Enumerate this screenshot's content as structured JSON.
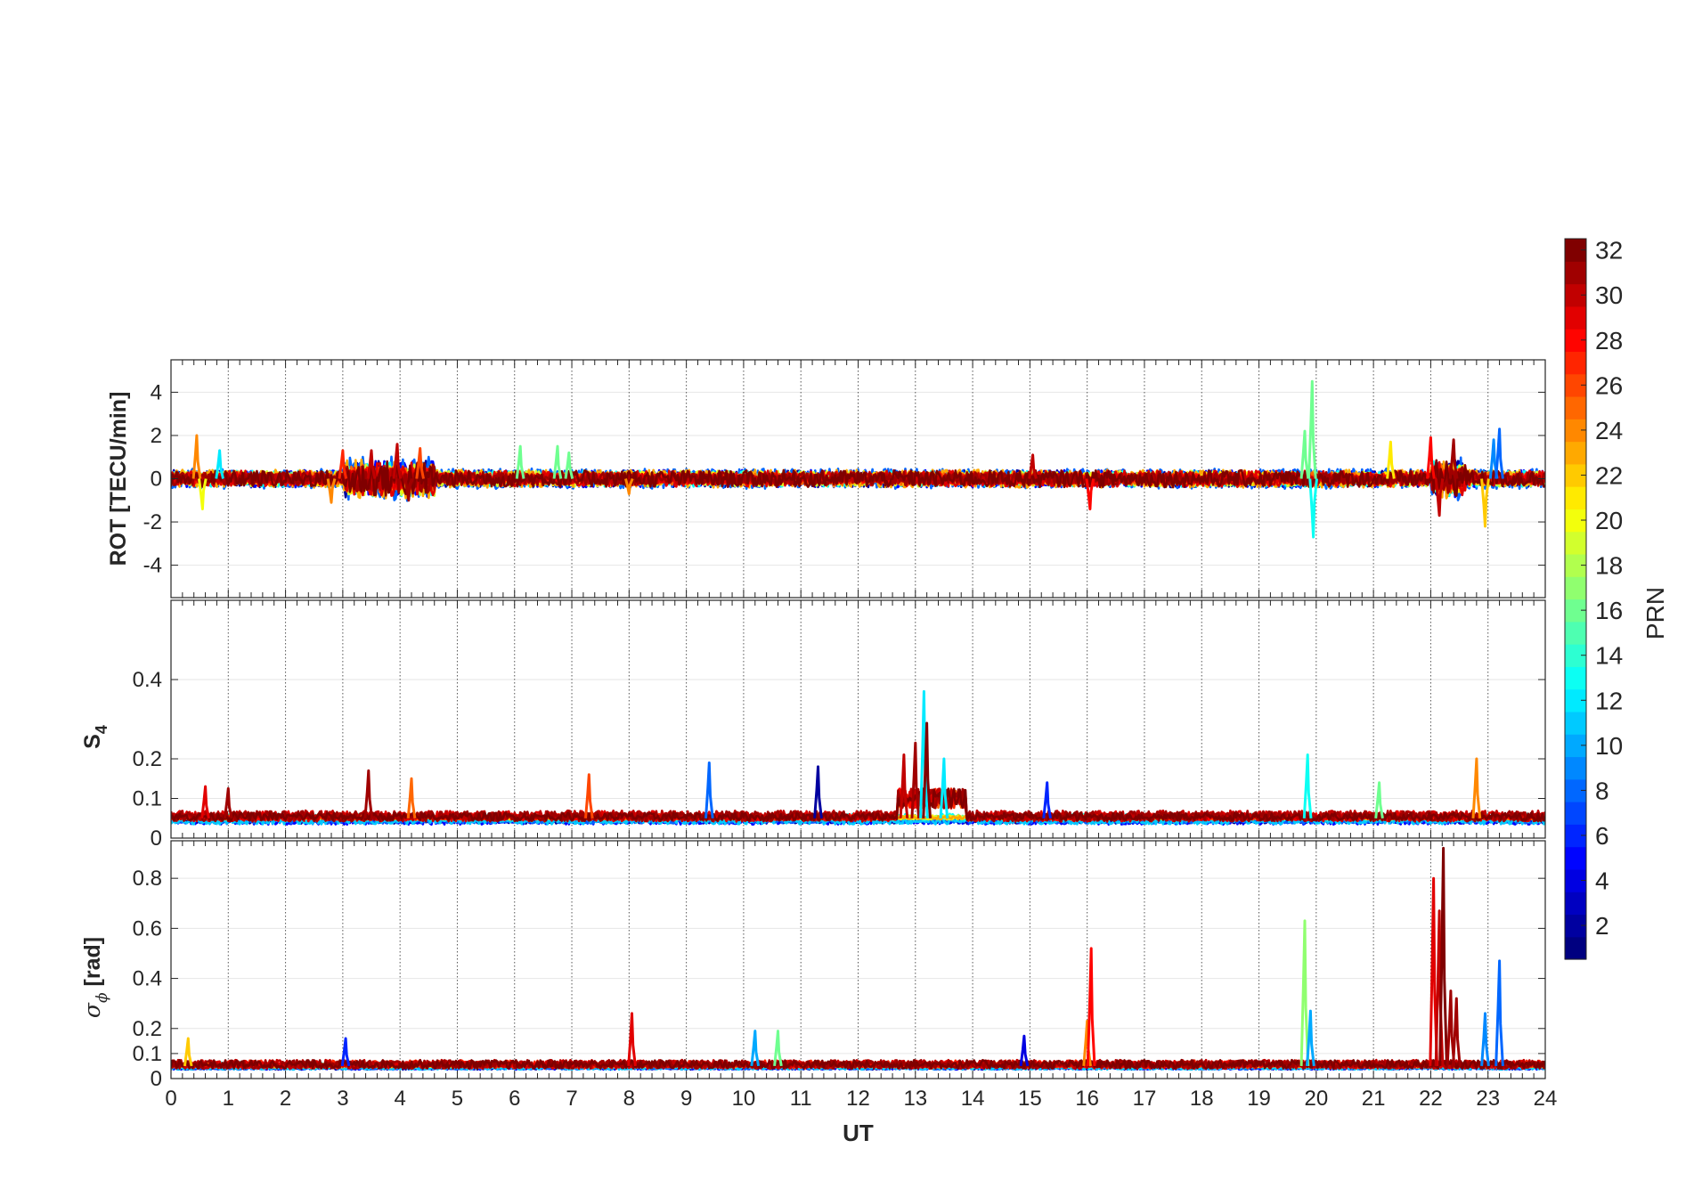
{
  "chart_data": [
    {
      "type": "line",
      "ylabel": "ROT [TECU/min]",
      "xlim": [
        0,
        24
      ],
      "ylim": [
        -5.5,
        5.5
      ],
      "yticks": [
        "-4",
        "-2",
        "0",
        "2",
        "4"
      ],
      "ytick_values": [
        -4,
        -2,
        0,
        2,
        4
      ],
      "grid": true,
      "series_note_color_by": "PRN",
      "baseline": 0,
      "noise_amplitude": 0.35,
      "events": [
        {
          "t": 0.45,
          "amp": 2.0,
          "prn": 24
        },
        {
          "t": 0.55,
          "amp": -1.4,
          "prn": 20
        },
        {
          "t": 0.85,
          "amp": 1.3,
          "prn": 12
        },
        {
          "t": 2.8,
          "amp": -1.1,
          "prn": 24
        },
        {
          "t": 3.0,
          "amp": 1.3,
          "prn": 27
        },
        {
          "t": 3.5,
          "amp": 1.3,
          "prn": 30
        },
        {
          "t": 3.95,
          "amp": 1.6,
          "prn": 30
        },
        {
          "t": 4.15,
          "amp": -1.0,
          "prn": 31
        },
        {
          "t": 4.35,
          "amp": 1.4,
          "prn": 26
        },
        {
          "t": 6.1,
          "amp": 1.5,
          "prn": 16
        },
        {
          "t": 6.75,
          "amp": 1.5,
          "prn": 16
        },
        {
          "t": 6.95,
          "amp": 1.2,
          "prn": 16
        },
        {
          "t": 8.0,
          "amp": -0.7,
          "prn": 24
        },
        {
          "t": 15.05,
          "amp": 1.1,
          "prn": 30
        },
        {
          "t": 16.05,
          "amp": -1.4,
          "prn": 28
        },
        {
          "t": 19.8,
          "amp": 2.2,
          "prn": 16
        },
        {
          "t": 19.93,
          "amp": 4.5,
          "prn": 16
        },
        {
          "t": 19.95,
          "amp": -2.7,
          "prn": 13
        },
        {
          "t": 21.3,
          "amp": 1.7,
          "prn": 21
        },
        {
          "t": 22.0,
          "amp": 1.9,
          "prn": 28
        },
        {
          "t": 22.15,
          "amp": -1.7,
          "prn": 30
        },
        {
          "t": 22.4,
          "amp": 1.8,
          "prn": 31
        },
        {
          "t": 22.95,
          "amp": -2.2,
          "prn": 22
        },
        {
          "t": 23.1,
          "amp": 1.8,
          "prn": 9
        },
        {
          "t": 23.2,
          "amp": 2.3,
          "prn": 8
        }
      ]
    },
    {
      "type": "line",
      "ylabel": "S4",
      "xlim": [
        0,
        24
      ],
      "ylim": [
        0,
        0.6
      ],
      "yticks": [
        "0",
        "0.1",
        "0.2",
        "0.4"
      ],
      "ytick_values": [
        0,
        0.1,
        0.2,
        0.4
      ],
      "grid": true,
      "baseline": 0.05,
      "noise_amplitude": 0.02,
      "events": [
        {
          "t": 0.6,
          "amp": 0.08,
          "prn": 29
        },
        {
          "t": 1.0,
          "amp": 0.075,
          "prn": 31
        },
        {
          "t": 3.45,
          "amp": 0.12,
          "prn": 31
        },
        {
          "t": 4.2,
          "amp": 0.1,
          "prn": 25
        },
        {
          "t": 7.3,
          "amp": 0.11,
          "prn": 26
        },
        {
          "t": 9.4,
          "amp": 0.14,
          "prn": 8
        },
        {
          "t": 11.3,
          "amp": 0.13,
          "prn": 2
        },
        {
          "t": 12.8,
          "amp": 0.16,
          "prn": 30
        },
        {
          "t": 13.0,
          "amp": 0.19,
          "prn": 31
        },
        {
          "t": 13.15,
          "amp": 0.32,
          "prn": 12
        },
        {
          "t": 13.2,
          "amp": 0.24,
          "prn": 32
        },
        {
          "t": 13.5,
          "amp": 0.15,
          "prn": 12
        },
        {
          "t": 15.3,
          "amp": 0.09,
          "prn": 6
        },
        {
          "t": 19.85,
          "amp": 0.16,
          "prn": 13
        },
        {
          "t": 21.1,
          "amp": 0.09,
          "prn": 16
        },
        {
          "t": 22.8,
          "amp": 0.15,
          "prn": 24
        }
      ],
      "plateau": {
        "start": 12.7,
        "end": 13.9,
        "level": 0.1
      }
    },
    {
      "type": "line",
      "ylabel": "σϕ [rad]",
      "xlabel": "UT",
      "xlim": [
        0,
        24
      ],
      "ylim": [
        0,
        0.95
      ],
      "xticks": [
        "0",
        "1",
        "2",
        "3",
        "4",
        "5",
        "6",
        "7",
        "8",
        "9",
        "10",
        "11",
        "12",
        "13",
        "14",
        "15",
        "16",
        "17",
        "18",
        "19",
        "20",
        "21",
        "22",
        "23",
        "24"
      ],
      "yticks": [
        "0",
        "0.1",
        "0.2",
        "0.4",
        "0.6",
        "0.8"
      ],
      "ytick_values": [
        0,
        0.1,
        0.2,
        0.4,
        0.6,
        0.8
      ],
      "grid": true,
      "baseline": 0.05,
      "noise_amplitude": 0.025,
      "events": [
        {
          "t": 0.3,
          "amp": 0.11,
          "prn": 22
        },
        {
          "t": 3.05,
          "amp": 0.11,
          "prn": 6
        },
        {
          "t": 8.05,
          "amp": 0.21,
          "prn": 29
        },
        {
          "t": 10.2,
          "amp": 0.14,
          "prn": 10
        },
        {
          "t": 10.6,
          "amp": 0.14,
          "prn": 16
        },
        {
          "t": 14.9,
          "amp": 0.12,
          "prn": 4
        },
        {
          "t": 16.0,
          "amp": 0.18,
          "prn": 24
        },
        {
          "t": 16.07,
          "amp": 0.47,
          "prn": 28
        },
        {
          "t": 19.8,
          "amp": 0.58,
          "prn": 17
        },
        {
          "t": 19.9,
          "amp": 0.22,
          "prn": 10
        },
        {
          "t": 22.05,
          "amp": 0.75,
          "prn": 29
        },
        {
          "t": 22.15,
          "amp": 0.62,
          "prn": 30
        },
        {
          "t": 22.22,
          "amp": 0.87,
          "prn": 32
        },
        {
          "t": 22.35,
          "amp": 0.3,
          "prn": 31
        },
        {
          "t": 22.45,
          "amp": 0.27,
          "prn": 31
        },
        {
          "t": 22.95,
          "amp": 0.21,
          "prn": 9
        },
        {
          "t": 23.2,
          "amp": 0.42,
          "prn": 8
        }
      ]
    }
  ],
  "colorbar": {
    "label": "PRN",
    "range": [
      1,
      32
    ],
    "ticks": [
      "2",
      "4",
      "6",
      "8",
      "10",
      "12",
      "14",
      "16",
      "18",
      "20",
      "22",
      "24",
      "26",
      "28",
      "30",
      "32"
    ],
    "tick_values": [
      2,
      4,
      6,
      8,
      10,
      12,
      14,
      16,
      18,
      20,
      22,
      24,
      26,
      28,
      30,
      32
    ],
    "colormap": "jet"
  }
}
